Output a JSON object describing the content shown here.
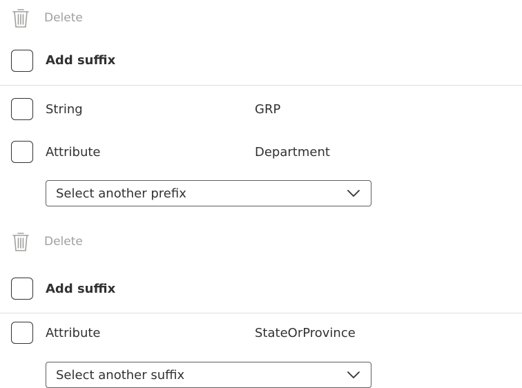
{
  "prefix_section": {
    "delete_label": "Delete",
    "add_suffix_label": "Add suffix",
    "rows": [
      {
        "label": "String",
        "value": "GRP"
      },
      {
        "label": "Attribute",
        "value": "Department"
      }
    ],
    "dropdown_value": "Select another prefix"
  },
  "suffix_section": {
    "delete_label": "Delete",
    "add_suffix_label": "Add suffix",
    "rows": [
      {
        "label": "Attribute",
        "value": "StateOrProvince"
      }
    ],
    "dropdown_value": "Select another suffix"
  },
  "icons": {
    "delete": "trash-icon",
    "dropdown": "chevron-down-icon"
  },
  "colors": {
    "disabled_text": "#a19f9d",
    "text": "#323130",
    "divider": "#e1dfdd"
  }
}
